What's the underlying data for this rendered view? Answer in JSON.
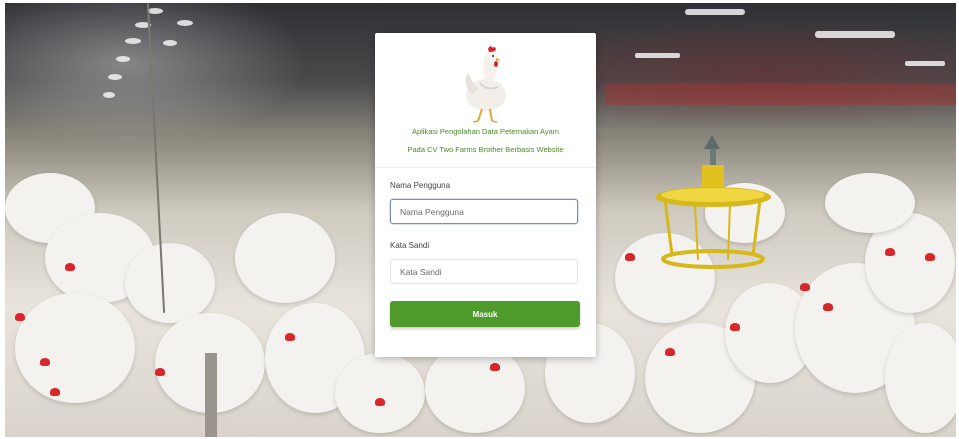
{
  "login": {
    "title_line1": "Aplikasi Pengolahan Data Peternakan Ayam",
    "title_line2": "Pada CV Two Farms Brother Berbasis Website",
    "username_label": "Nama Pengguna",
    "username_placeholder": "Nama Pengguna",
    "password_label": "Kata Sandi",
    "password_placeholder": "Kata Sandi",
    "submit_label": "Masuk"
  },
  "theme": {
    "accent": "#4e9a2b",
    "title_color": "#4a8a2a",
    "logo_icon": "chicken-icon"
  }
}
